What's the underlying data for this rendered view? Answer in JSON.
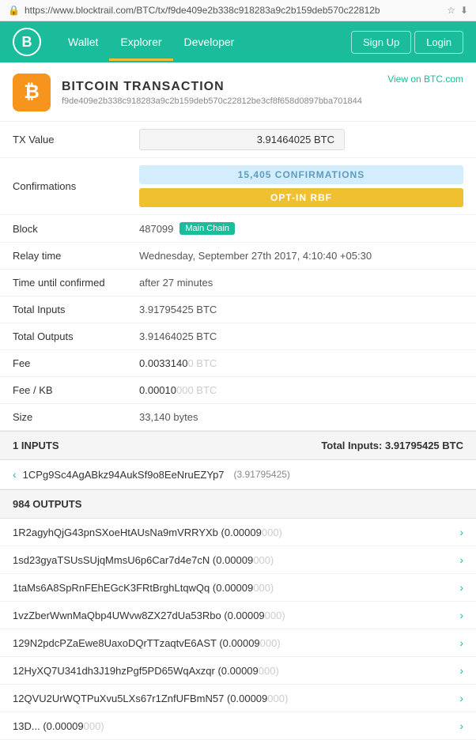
{
  "url": "https://www.blocktrail.com/BTC/tx/f9de409e2b338c918283a9c2b159deb570c22812b",
  "nav": {
    "logo": "B",
    "links": [
      "Wallet",
      "Explorer",
      "Developer"
    ],
    "active_link": "Explorer",
    "right_buttons": [
      "Sign Up",
      "Login"
    ]
  },
  "tx_header": {
    "title": "BITCOIN TRANSACTION",
    "view_link": "View on BTC.com",
    "hash": "f9de409e2b338c918283a9c2b159deb570c22812be3cf8f658d0897bba701844",
    "btc_symbol": "₿"
  },
  "tx_fields": {
    "tx_value_label": "TX Value",
    "tx_value": "3.91464025 BTC",
    "confirmations_label": "Confirmations",
    "confirmations": "15,405 CONFIRMATIONS",
    "rbf": "OPT-IN RBF",
    "block_label": "Block",
    "block_number": "487099",
    "block_chain": "Main Chain",
    "relay_time_label": "Relay time",
    "relay_time": "Wednesday, September 27th 2017, 4:10:40 +05:30",
    "time_confirmed_label": "Time until confirmed",
    "time_confirmed": "after 27 minutes",
    "total_inputs_label": "Total Inputs",
    "total_inputs": "3.91795425 BTC",
    "total_outputs_label": "Total Outputs",
    "total_outputs": "3.91464025 BTC",
    "fee_label": "Fee",
    "fee_main": "0.0033140",
    "fee_dim": "0 BTC",
    "fee_kb_label": "Fee / KB",
    "fee_kb_main": "0.00010",
    "fee_kb_dim": "000 BTC",
    "size_label": "Size",
    "size": "33,140 bytes"
  },
  "inputs_section": {
    "label": "1 INPUTS",
    "total_label": "Total Inputs:",
    "total_value": "3.91795425 BTC",
    "items": [
      {
        "address": "1CPg9Sc4AgABkz94AukSf9o8EeNruEZYp7",
        "amount": "(3.91795425)"
      }
    ]
  },
  "outputs_section": {
    "label": "984 OUTPUTS",
    "items": [
      {
        "address": "1R2agyhQjG43pnSXoeHtAUsNa9mVRRYXb",
        "amount": "(0.00009",
        "dim": "000)"
      },
      {
        "address": "1sd23gyaTSUsSUjqMmsU6p6Car7d4e7cN",
        "amount": "(0.00009",
        "dim": "000)"
      },
      {
        "address": "1taMs6A8SpRnFEhEGcK3FRtBrghLtqwQq",
        "amount": "(0.00009",
        "dim": "000)"
      },
      {
        "address": "1vzZberWwnMaQbp4UWvw8ZX27dUa53Rbo",
        "amount": "(0.00009",
        "dim": "000)"
      },
      {
        "address": "129N2pdcPZaEwe8UaxoDQrTTzaqtvE6AST",
        "amount": "(0.00009",
        "dim": "000)"
      },
      {
        "address": "12HyXQ7U341dh3J19hzPgf5PD65WqAxzqr",
        "amount": "(0.00009",
        "dim": "000)"
      },
      {
        "address": "12QVU2UrWQTPuXvu5LXs67r1ZnfUFBmN57",
        "amount": "(0.00009",
        "dim": "000)"
      },
      {
        "address": "13D...",
        "amount": "(0.00009",
        "dim": "000)"
      }
    ]
  }
}
